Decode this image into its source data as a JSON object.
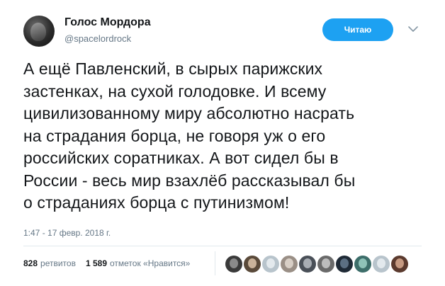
{
  "user": {
    "name": "Голос Мордора",
    "handle": "@spacelordrock"
  },
  "follow_button": {
    "label": "Читаю"
  },
  "tweet": {
    "lines": [
      "А ещё Павленский, в сырых парижских",
      "застенках, на сухой голодовке. И всему",
      "цивилизованному миру абсолютно насрать",
      "на страдания борца, не говоря уж о его",
      "российских соратниках. А вот сидел бы в",
      "России - весь мир взахлёб рассказывал бы",
      "о страданиях борца с путинизмом!"
    ],
    "timestamp": "1:47 - 17 февр. 2018 г."
  },
  "stats": {
    "retweets_count": "828",
    "retweets_label": "ретвитов",
    "likes_count": "1 589",
    "likes_label": "отметок «Нравится»"
  },
  "liker_avatars": [
    {
      "bg": "#3a3a3a",
      "fg": "#8a8a8a"
    },
    {
      "bg": "#5a4a3a",
      "fg": "#c9b29a"
    },
    {
      "bg": "#b8c4cc",
      "fg": "#e3e9ed"
    },
    {
      "bg": "#9a8f86",
      "fg": "#d8cfc6"
    },
    {
      "bg": "#4a5058",
      "fg": "#a8adb3"
    },
    {
      "bg": "#6a6a6a",
      "fg": "#bdbdbd"
    },
    {
      "bg": "#1f2a36",
      "fg": "#5c6f82"
    },
    {
      "bg": "#3d6e6a",
      "fg": "#8fc2b8"
    },
    {
      "bg": "#b8c4cc",
      "fg": "#e3e9ed"
    },
    {
      "bg": "#5b3a2e",
      "fg": "#c69a82"
    }
  ],
  "colors": {
    "accent": "#1da1f2",
    "text": "#14171a",
    "muted": "#657786",
    "divider": "#e1e8ed"
  }
}
